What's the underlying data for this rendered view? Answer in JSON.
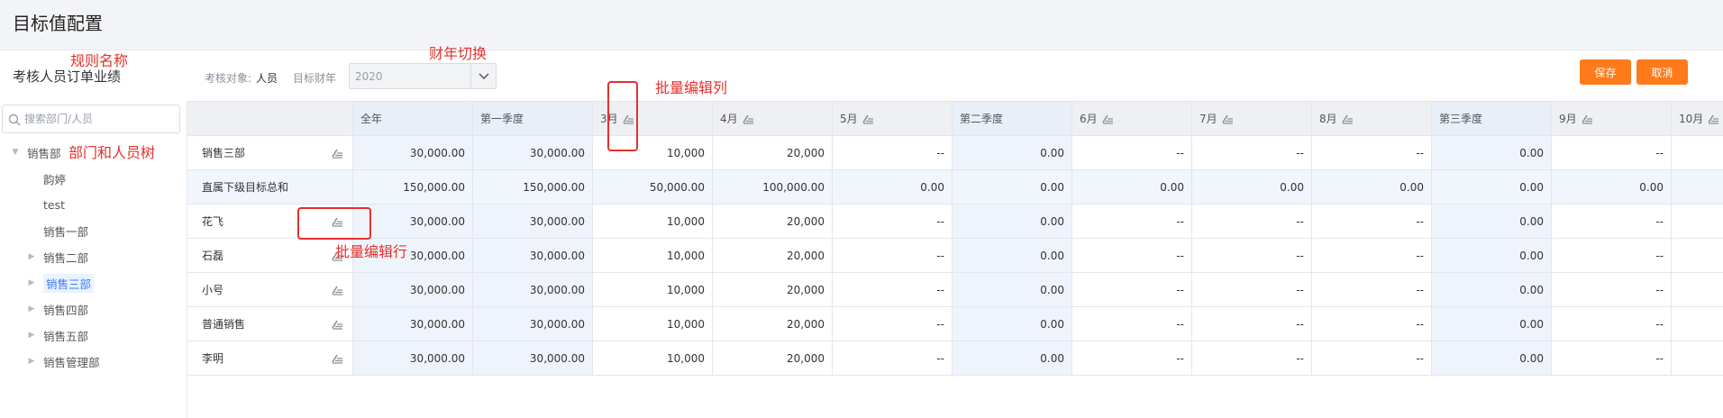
{
  "page": {
    "title": "目标值配置"
  },
  "rule": {
    "name": "考核人员订单业绩"
  },
  "filters": {
    "target_label": "考核对象:",
    "target_value": "人员",
    "year_label": "目标财年",
    "year_value": "2020"
  },
  "actions": {
    "save_label": "保存",
    "cancel_label": "取消"
  },
  "search": {
    "placeholder": "搜索部门/人员"
  },
  "tree": [
    {
      "label": "销售部",
      "caret": "down",
      "level": 0
    },
    {
      "label": "韵婷",
      "caret": "none",
      "level": 1
    },
    {
      "label": "test",
      "caret": "none",
      "level": 1
    },
    {
      "label": "销售一部",
      "caret": "none",
      "level": 1
    },
    {
      "label": "销售二部",
      "caret": "right",
      "level": 1
    },
    {
      "label": "销售三部",
      "caret": "right",
      "level": 1,
      "active": true
    },
    {
      "label": "销售四部",
      "caret": "right",
      "level": 1
    },
    {
      "label": "销售五部",
      "caret": "right",
      "level": 1
    },
    {
      "label": "销售管理部",
      "caret": "right",
      "level": 1
    }
  ],
  "table": {
    "columns": [
      "全年",
      "第一季度",
      "3月",
      "4月",
      "5月",
      "第二季度",
      "6月",
      "7月",
      "8月",
      "第三季度",
      "9月",
      "10月"
    ],
    "editable_columns": [
      false,
      false,
      true,
      true,
      true,
      false,
      true,
      true,
      true,
      false,
      true,
      true
    ],
    "sum_columns": [
      true,
      true,
      false,
      false,
      false,
      true,
      false,
      false,
      false,
      true,
      false,
      false
    ],
    "rows": [
      {
        "name": "销售三部",
        "editable": true,
        "highlight": false,
        "values": [
          "30,000.00",
          "30,000.00",
          "10,000",
          "20,000",
          "--",
          "0.00",
          "--",
          "--",
          "--",
          "0.00",
          "--",
          ""
        ]
      },
      {
        "name": "直属下级目标总和",
        "editable": false,
        "highlight": true,
        "values": [
          "150,000.00",
          "150,000.00",
          "50,000.00",
          "100,000.00",
          "0.00",
          "0.00",
          "0.00",
          "0.00",
          "0.00",
          "0.00",
          "0.00",
          ""
        ]
      },
      {
        "name": "花飞",
        "editable": true,
        "highlight": false,
        "values": [
          "30,000.00",
          "30,000.00",
          "10,000",
          "20,000",
          "--",
          "0.00",
          "--",
          "--",
          "--",
          "0.00",
          "--",
          ""
        ]
      },
      {
        "name": "石磊",
        "editable": true,
        "highlight": false,
        "values": [
          "30,000.00",
          "30,000.00",
          "10,000",
          "20,000",
          "--",
          "0.00",
          "--",
          "--",
          "--",
          "0.00",
          "--",
          ""
        ]
      },
      {
        "name": "小号",
        "editable": true,
        "highlight": false,
        "values": [
          "30,000.00",
          "30,000.00",
          "10,000",
          "20,000",
          "--",
          "0.00",
          "--",
          "--",
          "--",
          "0.00",
          "--",
          ""
        ]
      },
      {
        "name": "普通销售",
        "editable": true,
        "highlight": false,
        "values": [
          "30,000.00",
          "30,000.00",
          "10,000",
          "20,000",
          "--",
          "0.00",
          "--",
          "--",
          "--",
          "0.00",
          "--",
          ""
        ]
      },
      {
        "name": "李明",
        "editable": true,
        "highlight": false,
        "values": [
          "30,000.00",
          "30,000.00",
          "10,000",
          "20,000",
          "--",
          "0.00",
          "--",
          "--",
          "--",
          "0.00",
          "--",
          ""
        ]
      }
    ]
  },
  "annotations": {
    "rule_name": "规则名称",
    "year_switch": "财年切换",
    "batch_column": "批量编辑列",
    "tree": "部门和人员树",
    "batch_row": "批量编辑行"
  },
  "colors": {
    "accent_orange": "#ff7a1a",
    "annotation_red": "#e5312c",
    "active_blue": "#3d7ef5"
  }
}
